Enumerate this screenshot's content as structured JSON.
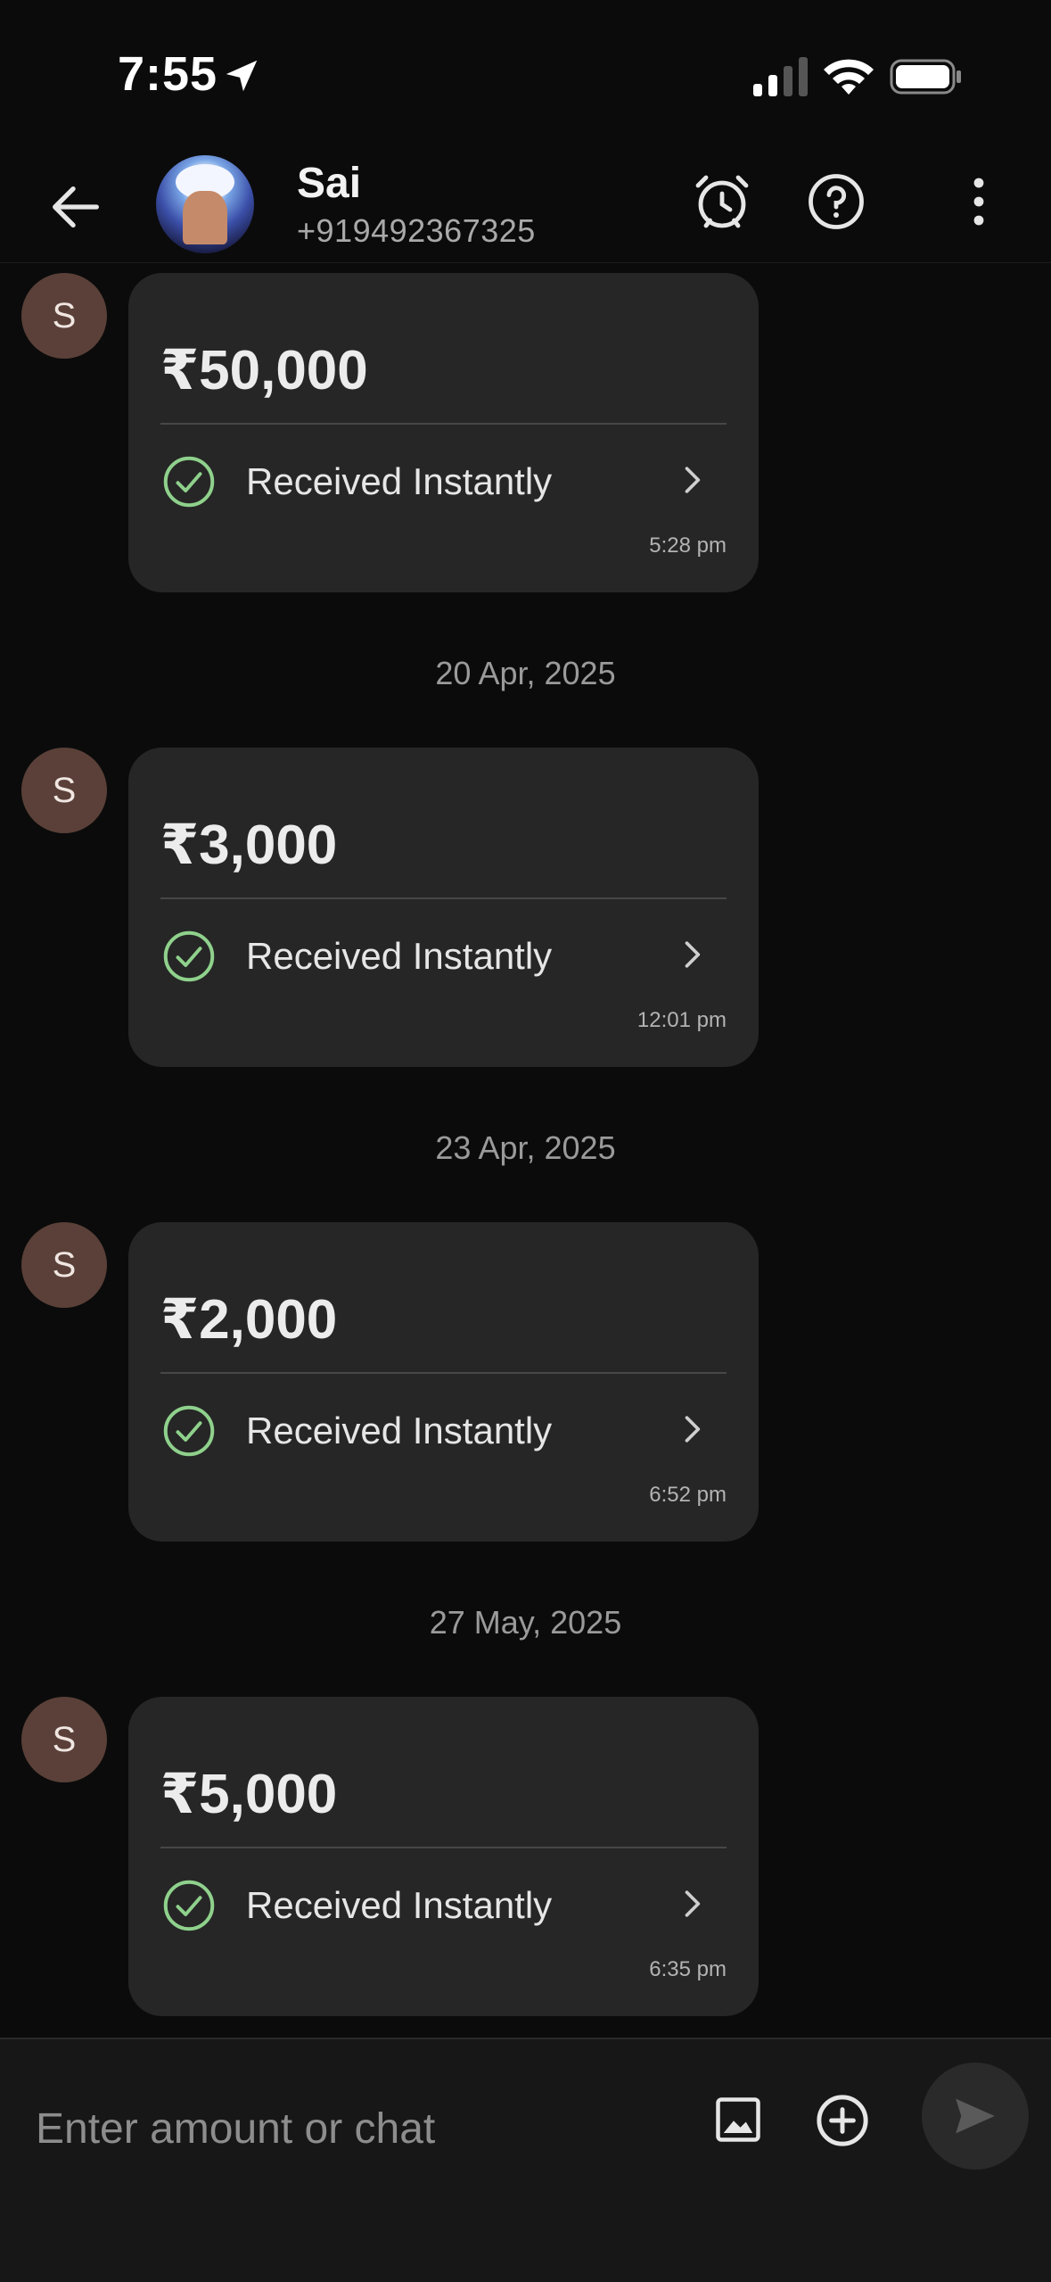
{
  "status_bar": {
    "time": "7:55"
  },
  "header": {
    "contact_name": "Sai",
    "contact_phone": "+919492367325"
  },
  "messages": [
    {
      "avatar_initial": "S",
      "amount": "₹50,000",
      "status": "Received Instantly",
      "time": "5:28 pm"
    },
    {
      "avatar_initial": "S",
      "amount": "₹3,000",
      "status": "Received Instantly",
      "time": "12:01 pm"
    },
    {
      "avatar_initial": "S",
      "amount": "₹2,000",
      "status": "Received Instantly",
      "time": "6:52 pm"
    },
    {
      "avatar_initial": "S",
      "amount": "₹5,000",
      "status": "Received Instantly",
      "time": "6:35 pm"
    }
  ],
  "date_separators": [
    "20 Apr, 2025",
    "23 Apr, 2025",
    "27 May, 2025"
  ],
  "composer": {
    "placeholder": "Enter amount or chat"
  },
  "icons": {
    "location": "location-arrow-icon",
    "signal": "cell-signal-icon",
    "wifi": "wifi-icon",
    "battery": "battery-icon",
    "back": "back-arrow-icon",
    "alarm": "alarm-clock-icon",
    "help": "help-icon",
    "more": "more-vertical-icon",
    "check": "check-circle-icon",
    "chevron": "chevron-right-icon",
    "image": "image-icon",
    "add": "add-circle-icon",
    "send": "send-icon"
  },
  "colors": {
    "background": "#0b0b0b",
    "card": "#262626",
    "success": "#8fd18c",
    "avatar": "#5a4038"
  }
}
